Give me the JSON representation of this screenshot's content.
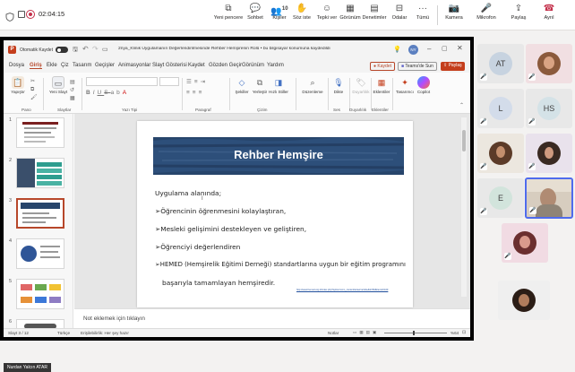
{
  "meeting": {
    "timer": "02:04:15",
    "controls": [
      {
        "icon": "new-window-icon",
        "label": "Yeni pencere"
      },
      {
        "icon": "chat-icon",
        "label": "Sohbet"
      },
      {
        "icon": "people-icon",
        "label": "Kişiler",
        "badge": "10"
      },
      {
        "icon": "raise-hand-icon",
        "label": "Söz iste"
      },
      {
        "icon": "react-icon",
        "label": "Tepki ver"
      },
      {
        "icon": "view-icon",
        "label": "Görünüm"
      },
      {
        "icon": "notes-icon",
        "label": "Denetimler"
      },
      {
        "icon": "rooms-icon",
        "label": "Odalar"
      },
      {
        "icon": "more-icon",
        "label": "Tümü"
      },
      {
        "icon": "camera-icon",
        "label": "Kamera"
      },
      {
        "icon": "mic-icon",
        "label": "Mikrofon"
      },
      {
        "icon": "share-icon",
        "label": "Paylaş"
      },
      {
        "icon": "leave-icon",
        "label": "Ayrıl"
      }
    ]
  },
  "ppt": {
    "autosave": "Otomatik Kaydet",
    "doc_title": "2nya_Klinik Uygulamanın Değerlendirilmesinde Rehber Hemşirenin Rolü • bu bilgisayar konumuna kaydedildi",
    "avatar_initials": "NY",
    "tabs": [
      "Dosya",
      "Giriş",
      "Ekle",
      "Çiz",
      "Tasarım",
      "Geçişler",
      "Animasyonlar",
      "Slayt Gösterisi",
      "Kaydet",
      "Gözden Geçir",
      "Görünüm",
      "Yardım"
    ],
    "record_btn": "Kaydet",
    "teams_btn": "Teams'de Sun",
    "share_btn": "Paylaş",
    "ribbon_buttons": [
      "Yapıştır",
      "Yeni Slayt",
      "Şekiller",
      "Yerleştir",
      "Hızlı Stiller",
      "Düzenleme",
      "Dikte",
      "Duyarlılık",
      "Eklentiler",
      "Tasarımcı",
      "Copilot"
    ],
    "ribbon_groups": [
      "Pano",
      "Slaytlar",
      "Yazı Tipi",
      "Paragraf",
      "Çizim",
      "Ses",
      "Duyarlılık",
      "Eklentiler"
    ],
    "thumb_numbers": [
      "1",
      "2",
      "3",
      "4",
      "5",
      "6"
    ],
    "notes_placeholder": "Not eklemek için tıklayın",
    "status_left": "Slayt 3 / 12",
    "status_lang": "Türkçe",
    "status_access": "Erişilebilirlik: Her şey hazır",
    "status_notes": "Notlar",
    "status_zoom": "%64",
    "presenter": "Nurdan Yalcın ATAR"
  },
  "slide": {
    "title": "Rehber Hemşire",
    "lines": [
      "Uygulama alanında;",
      "➢Öğrencinin öğrenmesini kolaylaştıran,",
      "➢Mesleki gelişimini destekleyen ve geliştiren,",
      "➢Öğrenciyi değerlendiren",
      "➢HEMED (Hemşirelik Eğitimi Derneği) standartlarına uygun bir eğitim programını",
      "başarıyla tamamlayan hemşiredir."
    ],
    "source_link": "http://www.hemed.org.tr/index.php?option=com_content&view=article&id=84&Itemid=100"
  },
  "participants": [
    {
      "type": "initials",
      "text": "AT",
      "bg": "#d9e2ea"
    },
    {
      "type": "photo",
      "tone": "#c98b6a",
      "bg": "#f1dfe2"
    },
    {
      "type": "initials",
      "text": "L",
      "bg": "#dfe6f0"
    },
    {
      "type": "initials",
      "text": "HS",
      "bg": "#e6edf0"
    },
    {
      "type": "photo",
      "tone": "#a86d4d",
      "bg": "#ece7df"
    },
    {
      "type": "photo",
      "tone": "#b77a5f",
      "bg": "#e9e2ec"
    },
    {
      "type": "initials",
      "text": "E",
      "bg": "#e0ebe6"
    },
    {
      "type": "video",
      "tone": "#b08b73",
      "bg": "#d7cdbf"
    },
    {
      "type": "photo",
      "tone": "#c46a7c",
      "bg": "#f1dbe3"
    },
    {
      "type": "photo",
      "tone": "#8a6249",
      "bg": "#efefef"
    }
  ]
}
